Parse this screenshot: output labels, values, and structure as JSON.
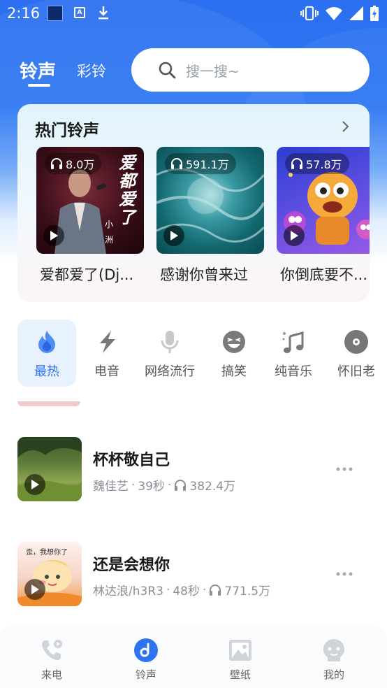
{
  "status_bar": {
    "time": "2:16"
  },
  "top_tabs": [
    {
      "label": "铃声",
      "active": true
    },
    {
      "label": "彩铃",
      "active": false
    }
  ],
  "search": {
    "placeholder": "搜一搜~"
  },
  "hot_section": {
    "title": "热门铃声",
    "items": [
      {
        "plays": "8.0万",
        "name": "爱都爱了(Dj...",
        "cover_text": [
          "爱",
          "都",
          "爱",
          "了"
        ],
        "cover_small": [
          "小",
          "洲"
        ]
      },
      {
        "plays": "591.1万",
        "name": "感谢你曾来过"
      },
      {
        "plays": "57.8万",
        "name": "你倒底要不..."
      }
    ]
  },
  "categories": [
    {
      "label": "最热",
      "icon": "flame-icon",
      "active": true
    },
    {
      "label": "电音",
      "icon": "lightning-icon",
      "active": false
    },
    {
      "label": "网络流行",
      "icon": "microphone-icon",
      "active": false
    },
    {
      "label": "搞笑",
      "icon": "laughing-face-icon",
      "active": false
    },
    {
      "label": "纯音乐",
      "icon": "music-note-icon",
      "active": false
    },
    {
      "label": "怀旧老",
      "icon": "vinyl-disc-icon",
      "active": false
    }
  ],
  "songs": [
    {
      "title": "杯杯敬自己",
      "artist": "魏佳艺",
      "duration": "39秒",
      "plays": "382.4万"
    },
    {
      "title": "还是会想你",
      "artist": "林达浪/h3R3",
      "duration": "48秒",
      "plays": "771.5万",
      "cover_text": "歪，我想你了"
    }
  ],
  "bottom_nav": [
    {
      "label": "来电",
      "icon": "phone-icon",
      "active": false
    },
    {
      "label": "铃声",
      "icon": "music-disc-icon",
      "active": true
    },
    {
      "label": "壁纸",
      "icon": "image-icon",
      "active": false
    },
    {
      "label": "我的",
      "icon": "profile-face-icon",
      "active": false
    }
  ],
  "colors": {
    "accent": "#2c74f2",
    "header_blue": "#2f78f3"
  }
}
